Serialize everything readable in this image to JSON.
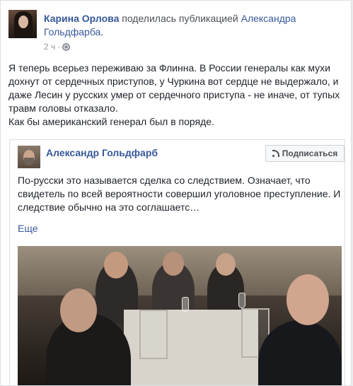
{
  "post": {
    "author": "Карина Орлова",
    "action": "поделилась публикацией",
    "shared_from": "Александра Гольдфарба",
    "time": "2 ч",
    "text_lines": [
      "Я теперь всерьез переживаю за Флинна. В России генералы как мухи",
      "дохнут от сердечных приступов, у Чуркина вот сердце не выдержало, и",
      "даже Лесин у русских умер от сердечного приступа - не иначе, от тупых",
      "травм головы отказало.",
      "Как бы американский генерал был в порядe."
    ]
  },
  "shared": {
    "author": "Александр Гольдфарб",
    "follow_label": "Подписаться",
    "text_lines": [
      "По-русски это называется сделка со следствием. Означает, что",
      "свидетель по всей вероятности совершил уголовное преступление. И",
      "следствие обычно на это соглашаетс…"
    ],
    "more_label": "Еще"
  },
  "icons": {
    "privacy": "globe-icon",
    "follow": "rss-icon"
  },
  "colors": {
    "link": "#365899",
    "meta": "#90949c",
    "text": "#1d2129"
  }
}
